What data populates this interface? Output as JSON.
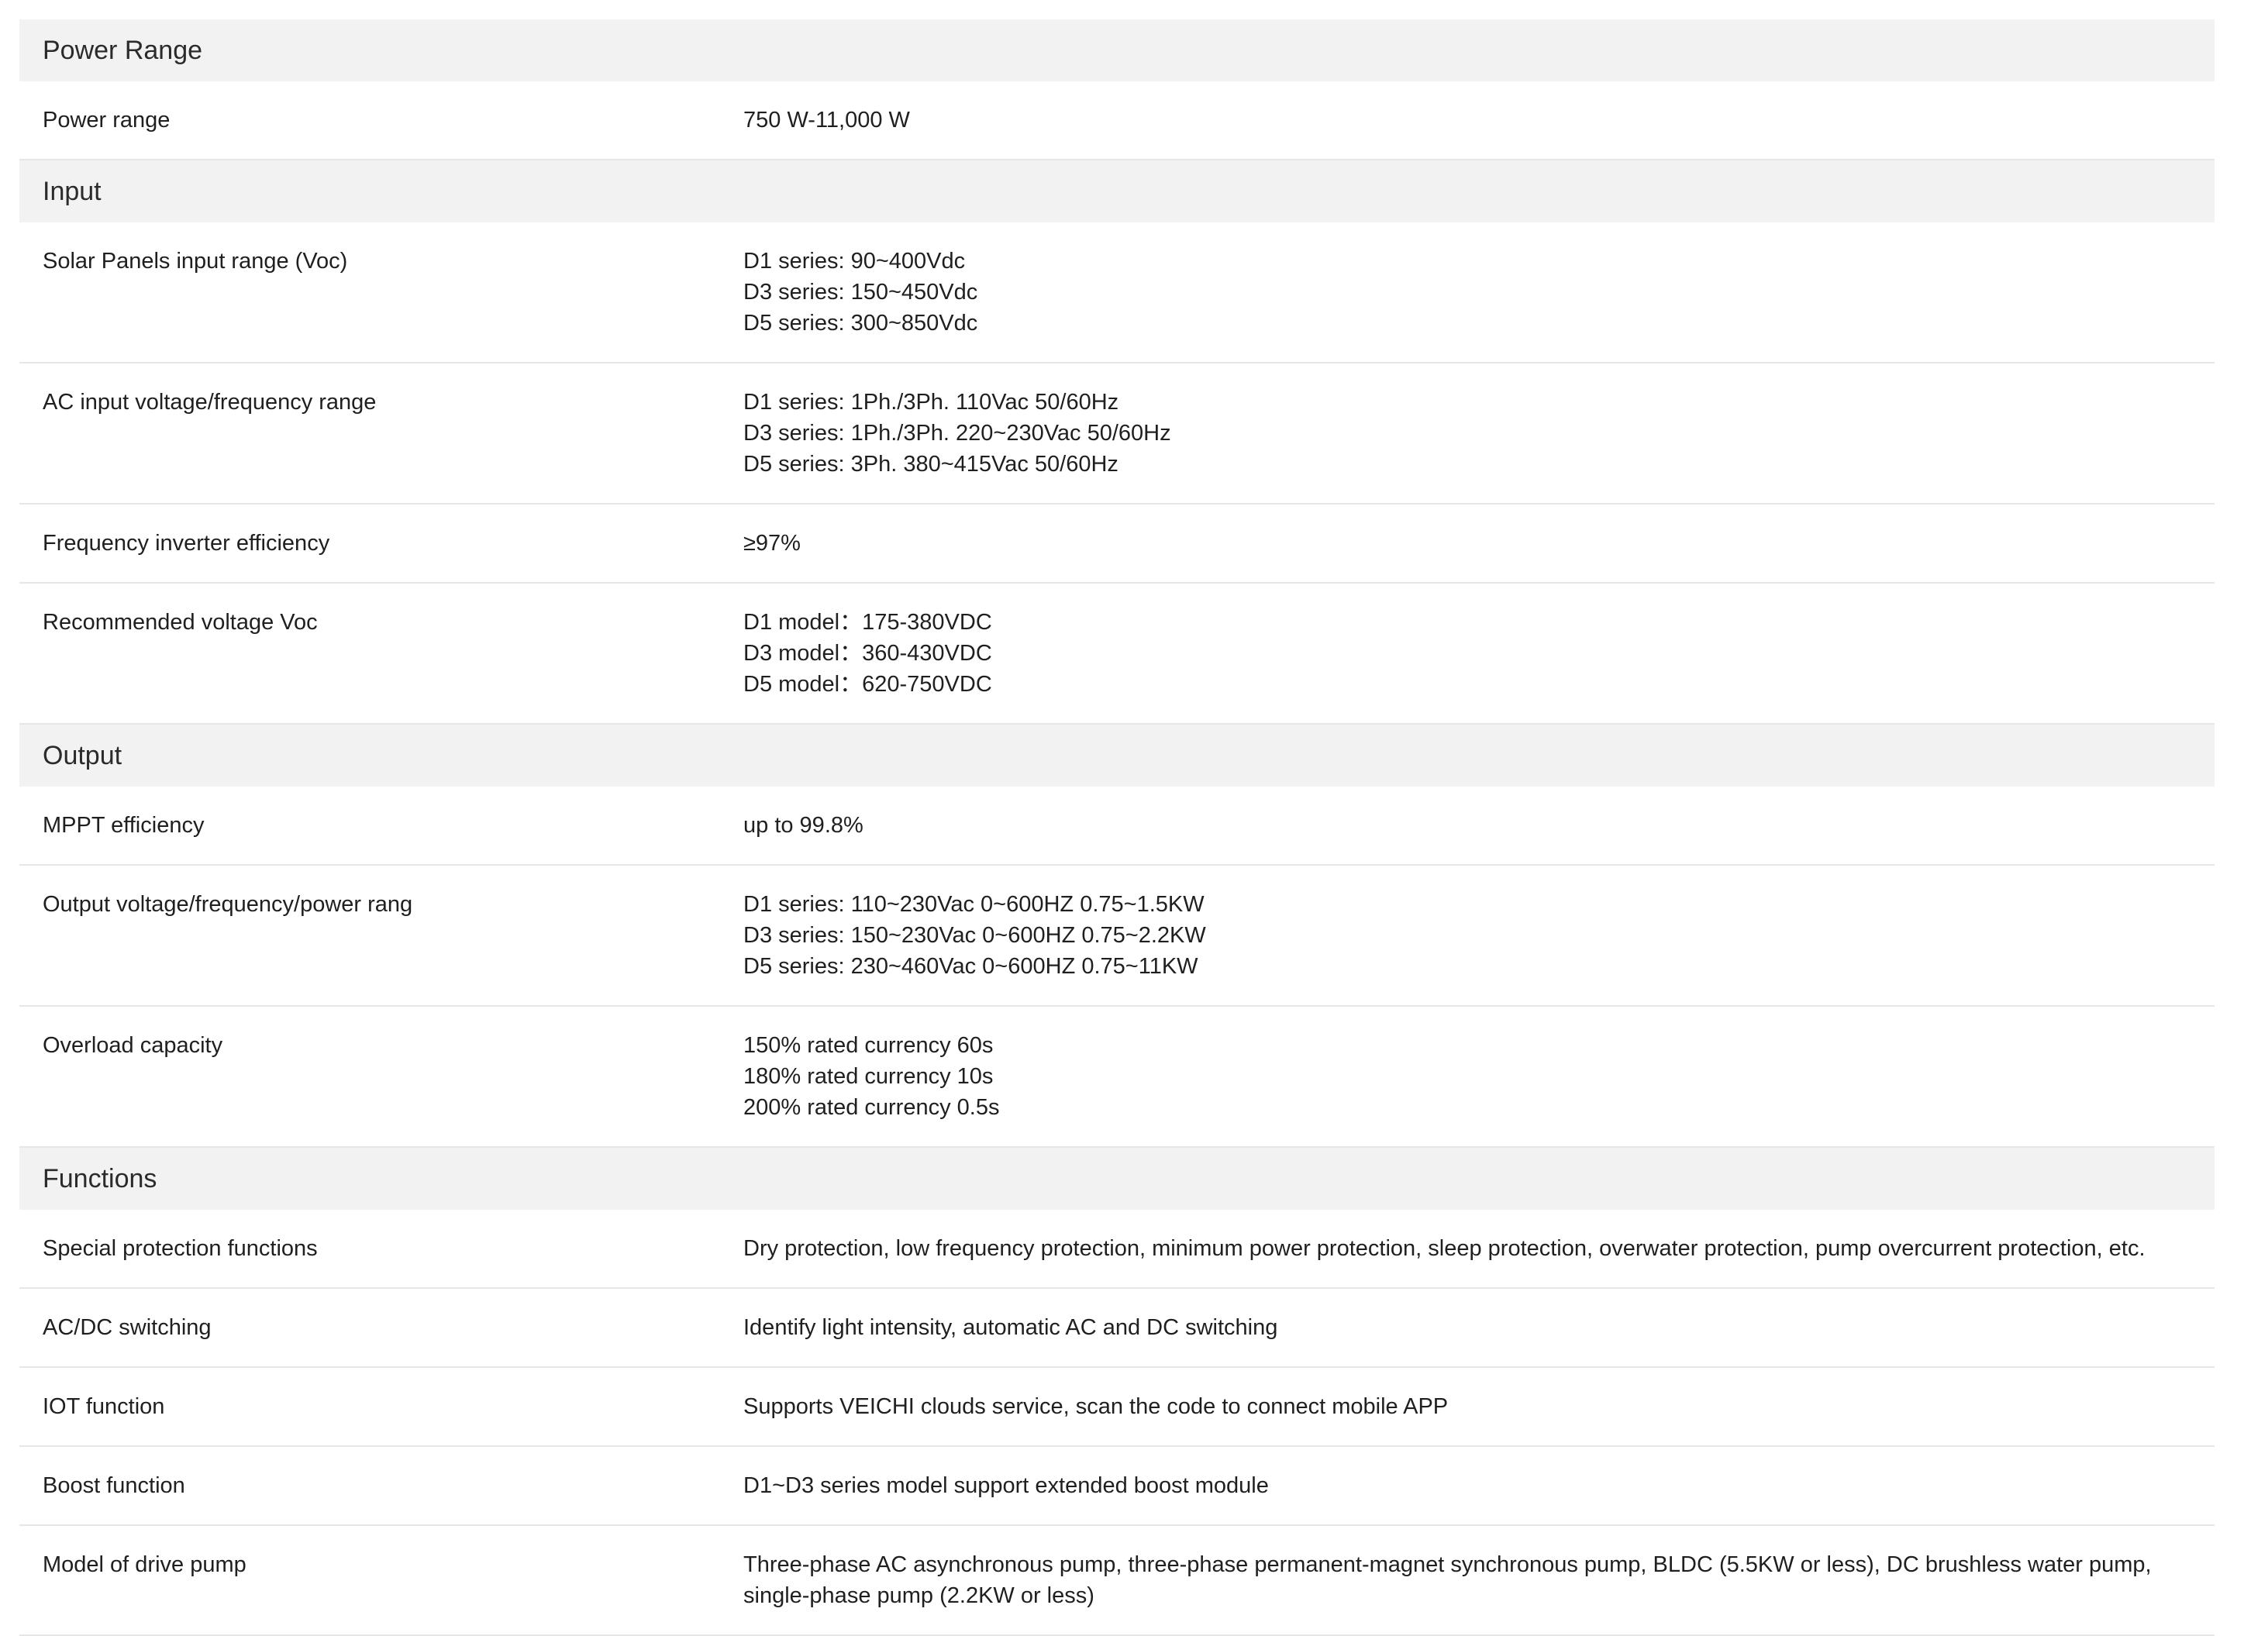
{
  "sections": [
    {
      "title": "Power Range",
      "rows": [
        {
          "label": "Power range",
          "values": [
            "750 W-11,000 W"
          ]
        }
      ]
    },
    {
      "title": "Input",
      "rows": [
        {
          "label": "Solar Panels input range (Voc)",
          "values": [
            "D1 series: 90~400Vdc",
            "D3 series: 150~450Vdc",
            "D5 series: 300~850Vdc"
          ]
        },
        {
          "label": "AC input voltage/frequency range",
          "values": [
            "D1 series: 1Ph./3Ph. 110Vac 50/60Hz",
            "D3 series: 1Ph./3Ph. 220~230Vac 50/60Hz",
            "D5 series: 3Ph. 380~415Vac 50/60Hz"
          ]
        },
        {
          "label": "Frequency inverter efficiency",
          "values": [
            "≥97%"
          ]
        },
        {
          "label": "Recommended voltage Voc",
          "values": [
            "D1 model：175-380VDC",
            "D3 model：360-430VDC",
            "D5 model：620-750VDC"
          ]
        }
      ]
    },
    {
      "title": "Output",
      "rows": [
        {
          "label": "MPPT efficiency",
          "values": [
            "up to 99.8%"
          ]
        },
        {
          "label": "Output voltage/frequency/power rang",
          "values": [
            "D1 series: 110~230Vac 0~600HZ 0.75~1.5KW",
            "D3 series: 150~230Vac 0~600HZ 0.75~2.2KW",
            "D5 series: 230~460Vac 0~600HZ 0.75~11KW"
          ]
        },
        {
          "label": "Overload capacity",
          "values": [
            "150% rated currency 60s",
            "180% rated currency 10s",
            "200% rated currency 0.5s"
          ]
        }
      ]
    },
    {
      "title": "Functions",
      "rows": [
        {
          "label": "Special protection functions",
          "values": [
            "Dry protection, low frequency protection, minimum power protection, sleep protection, overwater protection, pump overcurrent protection, etc."
          ]
        },
        {
          "label": "AC/DC switching",
          "values": [
            "Identify light intensity, automatic AC and DC switching"
          ]
        },
        {
          "label": "IOT function",
          "values": [
            "Supports VEICHI clouds service, scan the code to connect mobile APP"
          ]
        },
        {
          "label": "Boost function",
          "values": [
            "D1~D3 series model support extended boost module"
          ]
        },
        {
          "label": "Model of drive pump",
          "values": [
            "Three-phase AC asynchronous pump, three-phase permanent-magnet synchronous pump, BLDC (5.5KW or less), DC brushless water pump, single-phase pump (2.2KW or less)"
          ]
        }
      ]
    }
  ]
}
